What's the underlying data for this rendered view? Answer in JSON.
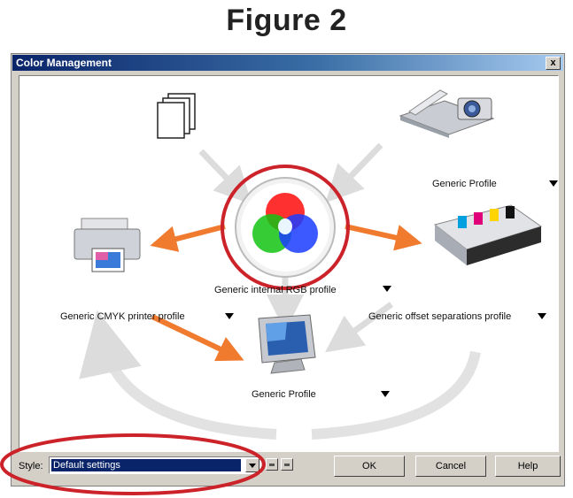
{
  "figure": {
    "title": "Figure 2"
  },
  "window": {
    "title": "Color Management",
    "close_label": "x"
  },
  "devices": {
    "internal": {
      "label": "Generic internal RGB profile",
      "icon": "rgb-color-wheel-icon"
    },
    "scanner": {
      "label": "Generic Profile",
      "icon": "scanner-camera-icon"
    },
    "printer": {
      "label": "Generic CMYK printer profile",
      "icon": "printer-icon"
    },
    "press": {
      "label": "Generic offset separations profile",
      "icon": "offset-press-icon"
    },
    "monitor": {
      "label": "Generic Profile",
      "icon": "monitor-icon"
    },
    "documents": {
      "icon": "documents-icon"
    }
  },
  "footer": {
    "style_label": "Style:",
    "style_value": "Default settings",
    "ok_label": "OK",
    "cancel_label": "Cancel",
    "help_label": "Help"
  },
  "colors": {
    "arrow_active": "#f07a2e",
    "arrow_inactive": "#dcdcdc",
    "highlight": "#cc2229",
    "title_start": "#0a246a",
    "title_end": "#a6caf0"
  }
}
